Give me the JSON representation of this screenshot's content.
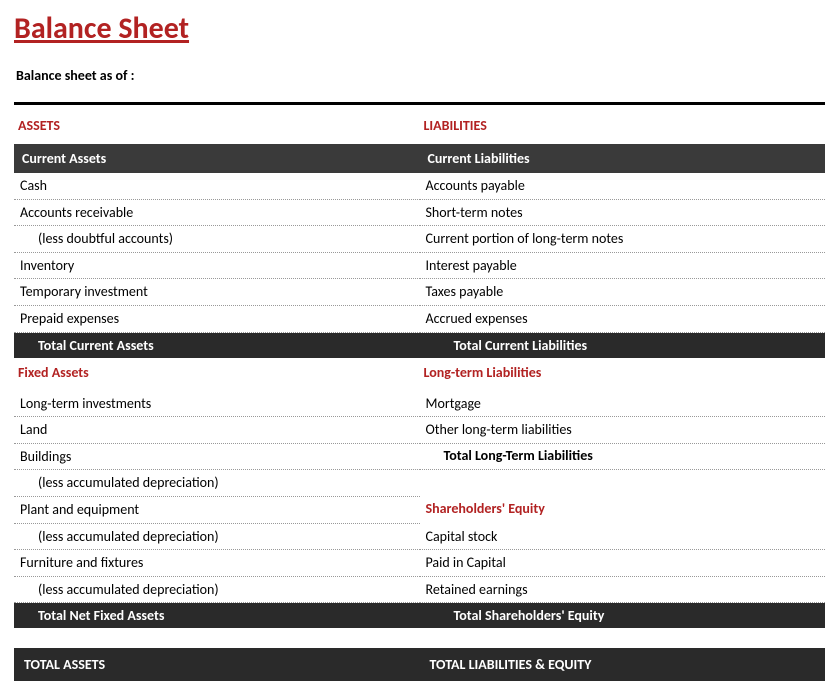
{
  "title": "Balance Sheet",
  "subtitle": "Balance sheet as of :",
  "left": {
    "section": "ASSETS",
    "current_header": "Current Assets",
    "current_items": [
      "Cash",
      "Accounts receivable",
      "(less doubtful accounts)",
      "Inventory",
      "Temporary investment",
      "Prepaid expenses"
    ],
    "current_total": "Total Current Assets",
    "fixed_header": "Fixed Assets",
    "fixed_items": [
      "Long-term investments",
      "Land",
      "Buildings",
      "(less accumulated depreciation)",
      "Plant and equipment",
      "(less accumulated depreciation)",
      "Furniture and fixtures",
      "(less accumulated depreciation)"
    ],
    "fixed_total": "Total Net Fixed Assets",
    "grand_total": "TOTAL ASSETS"
  },
  "right": {
    "section": "LIABILITIES",
    "current_header": "Current Liabilities",
    "current_items": [
      "Accounts payable",
      "Short-term notes",
      "Current portion of long-term notes",
      "Interest payable",
      "Taxes payable",
      "Accrued expenses"
    ],
    "current_total": "Total Current Liabilities",
    "lt_header": "Long-term Liabilities",
    "lt_items": [
      "Mortgage",
      "Other long-term liabilities"
    ],
    "lt_total": "Total Long-Term Liabilities",
    "eq_header": "Shareholders' Equity",
    "eq_items": [
      "Capital stock",
      "Paid in Capital",
      "Retained earnings"
    ],
    "eq_total": "Total Shareholders' Equity",
    "grand_total": "TOTAL LIABILITIES & EQUITY"
  }
}
